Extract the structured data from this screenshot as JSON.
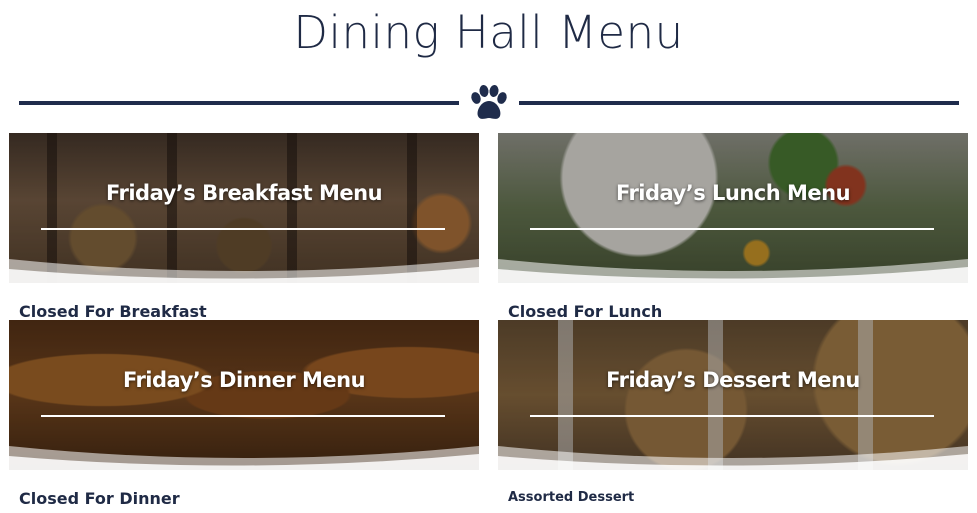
{
  "page": {
    "title": "Dining Hall Menu",
    "accent_color": "#1f2c4c",
    "divider_icon": "paw-icon"
  },
  "menus": [
    {
      "title": "Friday’s Breakfast Menu",
      "status": "Closed For Breakfast"
    },
    {
      "title": "Friday’s Lunch Menu",
      "status": "Closed For Lunch"
    },
    {
      "title": "Friday’s Dinner Menu",
      "status": "Closed For Dinner"
    },
    {
      "title": "Friday’s Dessert Menu",
      "status": "Assorted Dessert"
    }
  ]
}
